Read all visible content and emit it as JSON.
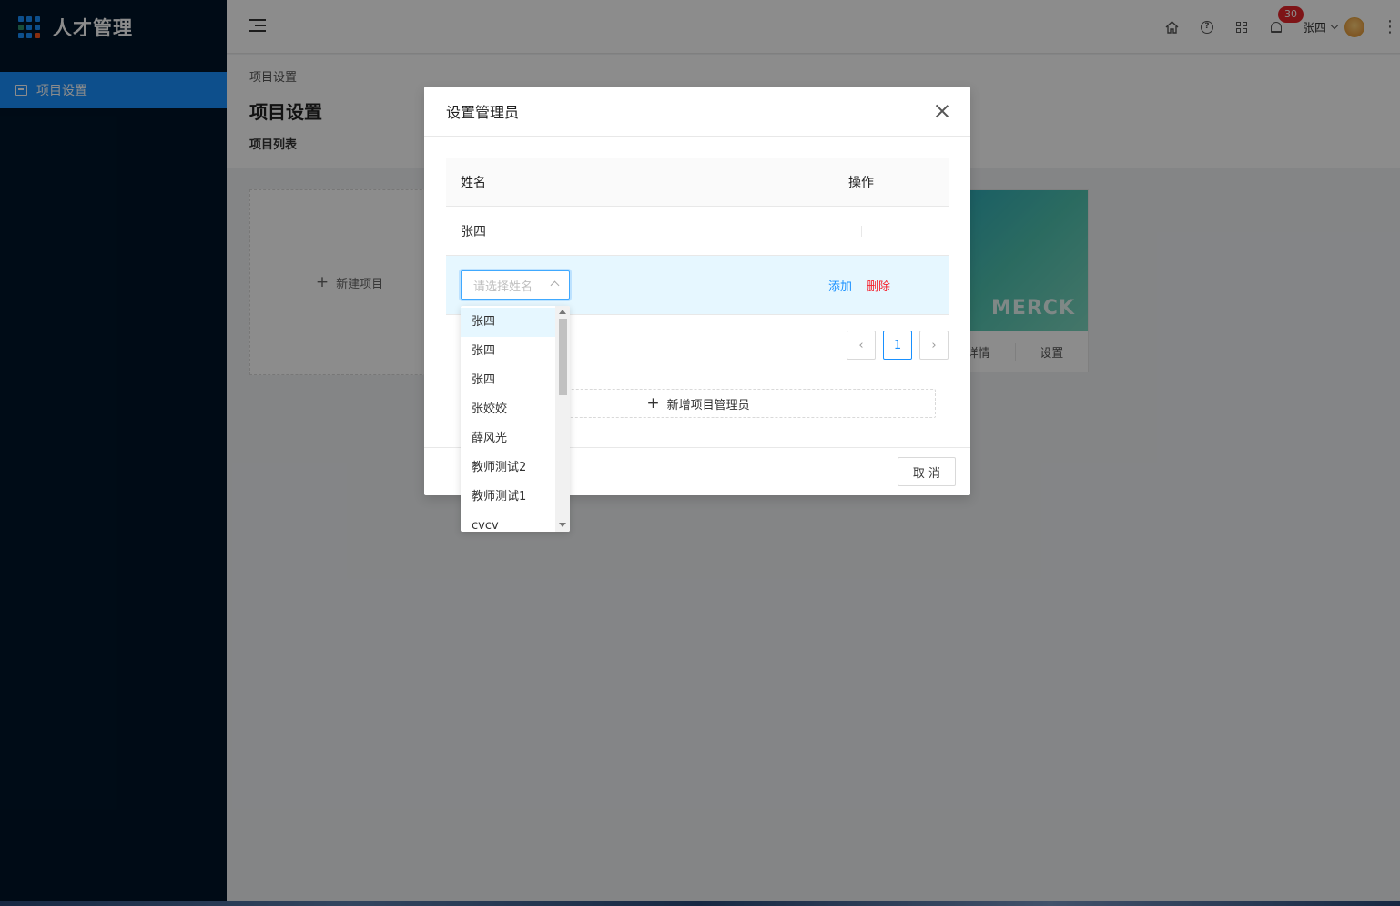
{
  "app": {
    "title": "人才管理"
  },
  "sidebar": {
    "items": [
      {
        "label": "项目设置",
        "icon": "project-settings-icon",
        "active": true
      }
    ]
  },
  "header": {
    "notifications": {
      "count": "30"
    },
    "user": {
      "name": "张四"
    }
  },
  "page": {
    "breadcrumb": "项目设置",
    "title": "项目设置",
    "subtitle": "项目列表",
    "new_project_label": "新建项目",
    "project_card": {
      "logo_text": "MERCK",
      "actions": [
        "详情",
        "设置"
      ]
    }
  },
  "modal": {
    "title": "设置管理员",
    "columns": [
      "姓名",
      "操作"
    ],
    "rows": [
      {
        "name": "张四"
      }
    ],
    "select": {
      "placeholder": "请选择姓名"
    },
    "actions": {
      "add": "添加",
      "delete": "删除"
    },
    "pagination": {
      "current": "1"
    },
    "add_admin_label": "新增项目管理员",
    "cancel_label": "取 消",
    "dropdown_options": [
      "张四",
      "张四",
      "张四",
      "张姣姣",
      "薛风光",
      "教师测试2",
      "教师测试1",
      "cvcv"
    ]
  },
  "colors": {
    "primary": "#1890ff",
    "sidebar": "#001529",
    "danger": "#f5222d",
    "badge": "#e5262b"
  }
}
